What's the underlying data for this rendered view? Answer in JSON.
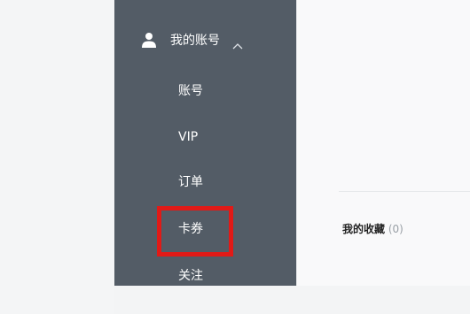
{
  "sidebar": {
    "account_label": "我的账号",
    "items": [
      {
        "label": "账号"
      },
      {
        "label": "VIP"
      },
      {
        "label": "订单"
      },
      {
        "label": "卡券"
      },
      {
        "label": "关注"
      }
    ]
  },
  "main": {
    "favorites_title": "我的收藏",
    "favorites_count": "(0)"
  },
  "colors": {
    "sidebar_bg": "#535c66",
    "highlight": "#e11a17"
  },
  "icons": {
    "account": "user-icon",
    "collapse": "chevron-up-icon"
  }
}
